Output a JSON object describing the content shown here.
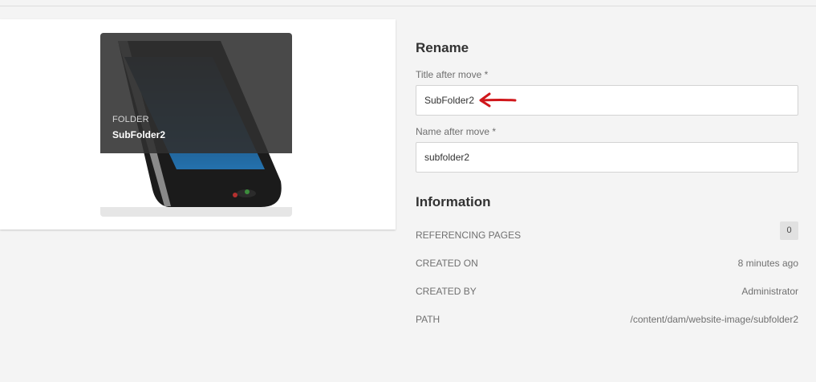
{
  "card": {
    "type_label": "FOLDER",
    "title": "SubFolder2",
    "thumbnail_icon": "phone-thumbnail"
  },
  "rename": {
    "heading": "Rename",
    "title_label": "Title after move *",
    "title_value": "SubFolder2",
    "name_label": "Name after move *",
    "name_value": "subfolder2",
    "annotation_color": "#d0171b"
  },
  "information": {
    "heading": "Information",
    "rows": [
      {
        "key": "REFERENCING PAGES",
        "value": "0"
      },
      {
        "key": "CREATED ON",
        "value": "8 minutes ago"
      },
      {
        "key": "CREATED BY",
        "value": "Administrator"
      },
      {
        "key": "PATH",
        "value": "/content/dam/website-image/subfolder2"
      }
    ]
  }
}
